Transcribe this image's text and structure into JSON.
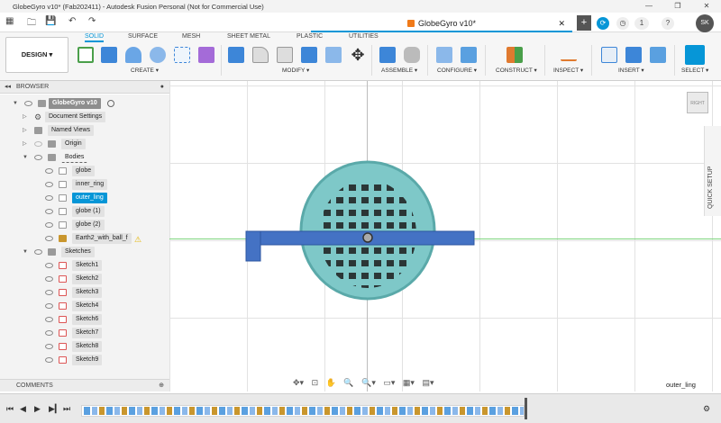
{
  "window": {
    "title": "GlobeGyro v10* (Fab202411) - Autodesk Fusion Personal (Not for Commercial Use)",
    "controls": [
      "—",
      "❐",
      "✕"
    ]
  },
  "tabbar": {
    "doc_tab": "GlobeGyro v10*",
    "close": "✕",
    "plus": "+",
    "job_count": "1",
    "user_initials": "SK"
  },
  "ribbon": {
    "workspace": "DESIGN",
    "tabs": [
      "SOLID",
      "SURFACE",
      "MESH",
      "SHEET METAL",
      "PLASTIC",
      "UTILITIES"
    ],
    "active_tab": "SOLID",
    "groups": [
      "CREATE ▾",
      "MODIFY ▾",
      "ASSEMBLE ▾",
      "CONFIGURE ▾",
      "CONSTRUCT ▾",
      "INSPECT ▾",
      "INSERT ▾",
      "SELECT ▾"
    ],
    "accent": "#0696d7"
  },
  "browser": {
    "title": "BROWSER",
    "items": [
      {
        "label": "GlobeGyro v10",
        "level": 0
      },
      {
        "label": "Document Settings",
        "level": 1
      },
      {
        "label": "Named Views",
        "level": 1
      },
      {
        "label": "Origin",
        "level": 1
      },
      {
        "label": "Bodies",
        "level": 1
      },
      {
        "label": "globe",
        "level": 2
      },
      {
        "label": "inner_ring",
        "level": 2
      },
      {
        "label": "outer_ling",
        "level": 2,
        "selected": true
      },
      {
        "label": "globe (1)",
        "level": 2
      },
      {
        "label": "globe (2)",
        "level": 2
      },
      {
        "label": "Earth2_with_ball_f",
        "level": 2,
        "warning": true
      },
      {
        "label": "Sketches",
        "level": 1
      },
      {
        "label": "Sketch1",
        "level": 2
      },
      {
        "label": "Sketch2",
        "level": 2
      },
      {
        "label": "Sketch3",
        "level": 2
      },
      {
        "label": "Sketch4",
        "level": 2
      },
      {
        "label": "Sketch6",
        "level": 2
      },
      {
        "label": "Sketch7",
        "level": 2
      },
      {
        "label": "Sketch8",
        "level": 2
      },
      {
        "label": "Sketch9",
        "level": 2
      }
    ]
  },
  "comments": {
    "title": "COMMENTS"
  },
  "viewport": {
    "viewcube_label": "RIGHT",
    "quick_setup": "QUICK SETUP",
    "selection_status": "outer_ling",
    "globe_color": "#7ec8c8",
    "ring_color": "#4472c4"
  }
}
